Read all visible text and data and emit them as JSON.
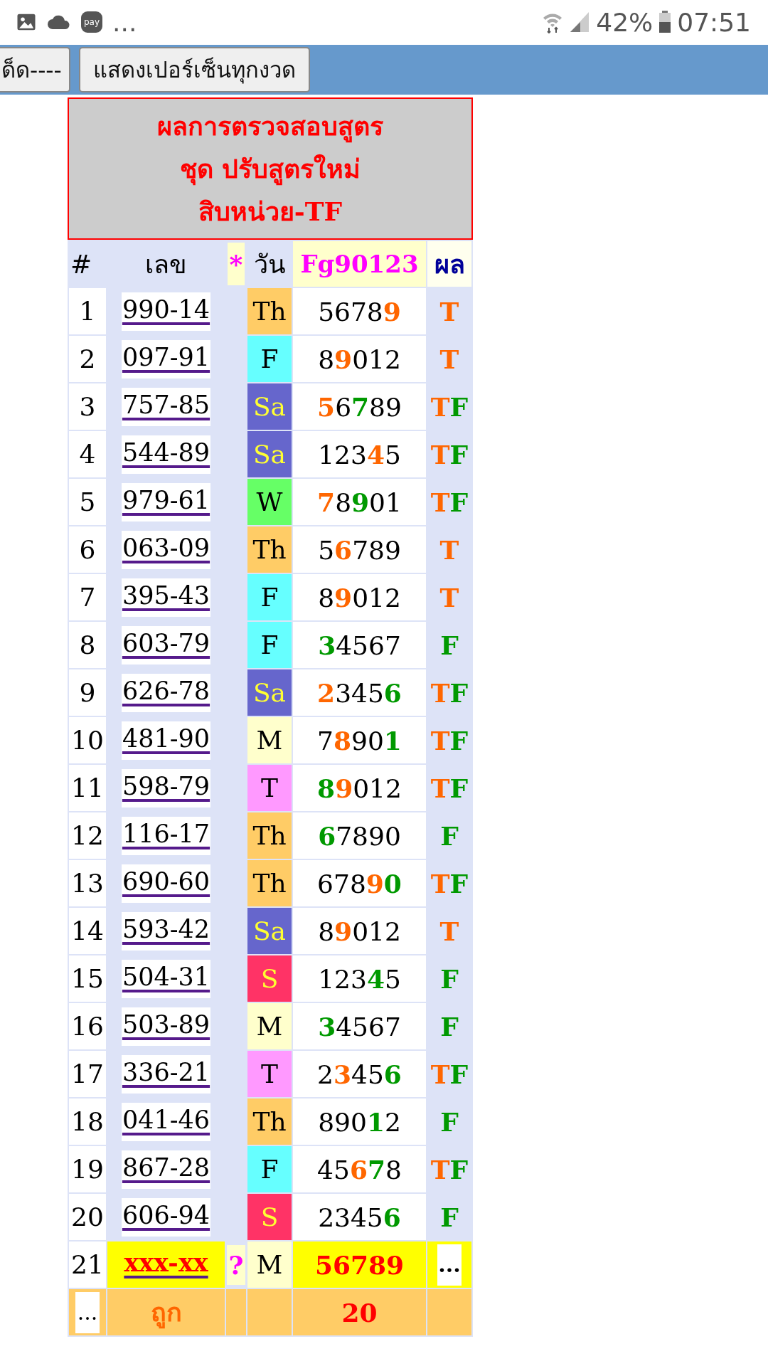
{
  "status_bar": {
    "pay_badge": "pay",
    "more": "...",
    "battery_percent": "42%",
    "time": "07:51"
  },
  "toolbar": {
    "buttons": [
      "ด็ด----",
      "แสดงเปอร์เซ็นทุกงวด"
    ]
  },
  "title": [
    "ผลการตรวจสอบสูตร",
    "ชุด ปรับสูตรใหม่",
    "สิบหน่วย-TF"
  ],
  "table": {
    "columns": [
      "#",
      "เลข",
      "*",
      "วัน",
      "Fg90123",
      "ผล"
    ],
    "rows": [
      {
        "index": "1",
        "number": "990-14",
        "day": "Th",
        "color": "#ffcc66",
        "digits": [
          {
            "text": "5678",
            "kind": "plain"
          },
          {
            "text": "9",
            "kind": "t"
          }
        ],
        "result": [
          {
            "text": "T",
            "kind": "t"
          }
        ]
      },
      {
        "index": "2",
        "number": "097-91",
        "day": "F",
        "color": "#66ffff",
        "digits": [
          {
            "text": "8",
            "kind": "plain"
          },
          {
            "text": "9",
            "kind": "t"
          },
          {
            "text": "012",
            "kind": "plain"
          }
        ],
        "result": [
          {
            "text": "T",
            "kind": "t"
          }
        ]
      },
      {
        "index": "3",
        "number": "757-85",
        "day": "Sa",
        "color": "#6666cc",
        "digits": [
          {
            "text": "5",
            "kind": "t"
          },
          {
            "text": "6",
            "kind": "plain"
          },
          {
            "text": "7",
            "kind": "f"
          },
          {
            "text": "89",
            "kind": "plain"
          }
        ],
        "result": [
          {
            "text": "T",
            "kind": "t"
          },
          {
            "text": "F",
            "kind": "f"
          }
        ]
      },
      {
        "index": "4",
        "number": "544-89",
        "day": "Sa",
        "color": "#6666cc",
        "digits": [
          {
            "text": "123",
            "kind": "plain"
          },
          {
            "text": "4",
            "kind": "t"
          },
          {
            "text": "5",
            "kind": "plain"
          }
        ],
        "result": [
          {
            "text": "T",
            "kind": "t"
          },
          {
            "text": "F",
            "kind": "f"
          }
        ]
      },
      {
        "index": "5",
        "number": "979-61",
        "day": "W",
        "color": "#66ff66",
        "digits": [
          {
            "text": "7",
            "kind": "t"
          },
          {
            "text": "8",
            "kind": "plain"
          },
          {
            "text": "9",
            "kind": "f"
          },
          {
            "text": "01",
            "kind": "plain"
          }
        ],
        "result": [
          {
            "text": "T",
            "kind": "t"
          },
          {
            "text": "F",
            "kind": "f"
          }
        ]
      },
      {
        "index": "6",
        "number": "063-09",
        "day": "Th",
        "color": "#ffcc66",
        "digits": [
          {
            "text": "5",
            "kind": "plain"
          },
          {
            "text": "6",
            "kind": "t"
          },
          {
            "text": "789",
            "kind": "plain"
          }
        ],
        "result": [
          {
            "text": "T",
            "kind": "t"
          }
        ]
      },
      {
        "index": "7",
        "number": "395-43",
        "day": "F",
        "color": "#66ffff",
        "digits": [
          {
            "text": "8",
            "kind": "plain"
          },
          {
            "text": "9",
            "kind": "t"
          },
          {
            "text": "012",
            "kind": "plain"
          }
        ],
        "result": [
          {
            "text": "T",
            "kind": "t"
          }
        ]
      },
      {
        "index": "8",
        "number": "603-79",
        "day": "F",
        "color": "#66ffff",
        "digits": [
          {
            "text": "3",
            "kind": "f"
          },
          {
            "text": "4567",
            "kind": "plain"
          }
        ],
        "result": [
          {
            "text": "F",
            "kind": "f"
          }
        ]
      },
      {
        "index": "9",
        "number": "626-78",
        "day": "Sa",
        "color": "#6666cc",
        "digits": [
          {
            "text": "2",
            "kind": "t"
          },
          {
            "text": "345",
            "kind": "plain"
          },
          {
            "text": "6",
            "kind": "f"
          }
        ],
        "result": [
          {
            "text": "T",
            "kind": "t"
          },
          {
            "text": "F",
            "kind": "f"
          }
        ]
      },
      {
        "index": "10",
        "number": "481-90",
        "day": "M",
        "color": "#ffffcc",
        "digits": [
          {
            "text": "7",
            "kind": "plain"
          },
          {
            "text": "8",
            "kind": "t"
          },
          {
            "text": "90",
            "kind": "plain"
          },
          {
            "text": "1",
            "kind": "f"
          }
        ],
        "result": [
          {
            "text": "T",
            "kind": "t"
          },
          {
            "text": "F",
            "kind": "f"
          }
        ]
      },
      {
        "index": "11",
        "number": "598-79",
        "day": "T",
        "color": "#ff99ff",
        "digits": [
          {
            "text": "8",
            "kind": "f"
          },
          {
            "text": "9",
            "kind": "t"
          },
          {
            "text": "012",
            "kind": "plain"
          }
        ],
        "result": [
          {
            "text": "T",
            "kind": "t"
          },
          {
            "text": "F",
            "kind": "f"
          }
        ]
      },
      {
        "index": "12",
        "number": "116-17",
        "day": "Th",
        "color": "#ffcc66",
        "digits": [
          {
            "text": "6",
            "kind": "f"
          },
          {
            "text": "7890",
            "kind": "plain"
          }
        ],
        "result": [
          {
            "text": "F",
            "kind": "f"
          }
        ]
      },
      {
        "index": "13",
        "number": "690-60",
        "day": "Th",
        "color": "#ffcc66",
        "digits": [
          {
            "text": "678",
            "kind": "plain"
          },
          {
            "text": "9",
            "kind": "t"
          },
          {
            "text": "0",
            "kind": "f"
          }
        ],
        "result": [
          {
            "text": "T",
            "kind": "t"
          },
          {
            "text": "F",
            "kind": "f"
          }
        ]
      },
      {
        "index": "14",
        "number": "593-42",
        "day": "Sa",
        "color": "#6666cc",
        "digits": [
          {
            "text": "8",
            "kind": "plain"
          },
          {
            "text": "9",
            "kind": "t"
          },
          {
            "text": "012",
            "kind": "plain"
          }
        ],
        "result": [
          {
            "text": "T",
            "kind": "t"
          }
        ]
      },
      {
        "index": "15",
        "number": "504-31",
        "day": "S",
        "color": "#ff3366",
        "digits": [
          {
            "text": "123",
            "kind": "plain"
          },
          {
            "text": "4",
            "kind": "f"
          },
          {
            "text": "5",
            "kind": "plain"
          }
        ],
        "result": [
          {
            "text": "F",
            "kind": "f"
          }
        ]
      },
      {
        "index": "16",
        "number": "503-89",
        "day": "M",
        "color": "#ffffcc",
        "digits": [
          {
            "text": "3",
            "kind": "f"
          },
          {
            "text": "4567",
            "kind": "plain"
          }
        ],
        "result": [
          {
            "text": "F",
            "kind": "f"
          }
        ]
      },
      {
        "index": "17",
        "number": "336-21",
        "day": "T",
        "color": "#ff99ff",
        "digits": [
          {
            "text": "2",
            "kind": "plain"
          },
          {
            "text": "3",
            "kind": "t"
          },
          {
            "text": "45",
            "kind": "plain"
          },
          {
            "text": "6",
            "kind": "f"
          }
        ],
        "result": [
          {
            "text": "T",
            "kind": "t"
          },
          {
            "text": "F",
            "kind": "f"
          }
        ]
      },
      {
        "index": "18",
        "number": "041-46",
        "day": "Th",
        "color": "#ffcc66",
        "digits": [
          {
            "text": "890",
            "kind": "plain"
          },
          {
            "text": "1",
            "kind": "f"
          },
          {
            "text": "2",
            "kind": "plain"
          }
        ],
        "result": [
          {
            "text": "F",
            "kind": "f"
          }
        ]
      },
      {
        "index": "19",
        "number": "867-28",
        "day": "F",
        "color": "#66ffff",
        "digits": [
          {
            "text": "45",
            "kind": "plain"
          },
          {
            "text": "6",
            "kind": "t"
          },
          {
            "text": "7",
            "kind": "f"
          },
          {
            "text": "8",
            "kind": "plain"
          }
        ],
        "result": [
          {
            "text": "T",
            "kind": "t"
          },
          {
            "text": "F",
            "kind": "f"
          }
        ]
      },
      {
        "index": "20",
        "number": "606-94",
        "day": "S",
        "color": "#ff3366",
        "digits": [
          {
            "text": "2345",
            "kind": "plain"
          },
          {
            "text": "6",
            "kind": "f"
          }
        ],
        "result": [
          {
            "text": "F",
            "kind": "f"
          }
        ]
      }
    ],
    "next_row": {
      "index": "21",
      "number": "xxx-xx",
      "mark": "?",
      "day": "M",
      "color": "#ffffcc",
      "prediction": "56789",
      "result": "..."
    },
    "footer": {
      "more": "...",
      "label": "ถูก",
      "count": "20"
    }
  }
}
